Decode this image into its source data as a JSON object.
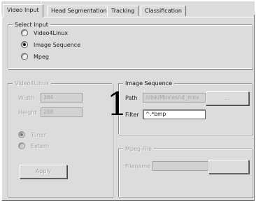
{
  "tabs": [
    {
      "label": "Video Input",
      "active": true
    },
    {
      "label": "Head Segmentation",
      "active": false
    },
    {
      "label": "Tracking",
      "active": false
    },
    {
      "label": "Classification",
      "active": false
    }
  ],
  "select_input": {
    "title": "Select Input",
    "options": [
      {
        "label": "Video4Linux",
        "selected": false
      },
      {
        "label": "Image Sequence",
        "selected": true
      },
      {
        "label": "Mpeg",
        "selected": false
      }
    ]
  },
  "video4linux": {
    "title": "Video4Linux",
    "width_label": "Width",
    "width_value": "384",
    "height_label": "Height",
    "height_value": "288",
    "source_options": [
      {
        "label": "Tuner",
        "selected": true
      },
      {
        "label": "Extern",
        "selected": false
      }
    ],
    "apply_label": "Apply"
  },
  "image_sequence": {
    "title": "Image Sequence",
    "path_label": "Path",
    "path_value": "/disk/Movies/ut_mov",
    "browse_label": "...",
    "filter_label": "Filter",
    "filter_value": "^.*bmp"
  },
  "mpeg_file": {
    "title": "Mpeg File",
    "filename_label": "Filename",
    "filename_value": ""
  },
  "callout_number": "1"
}
